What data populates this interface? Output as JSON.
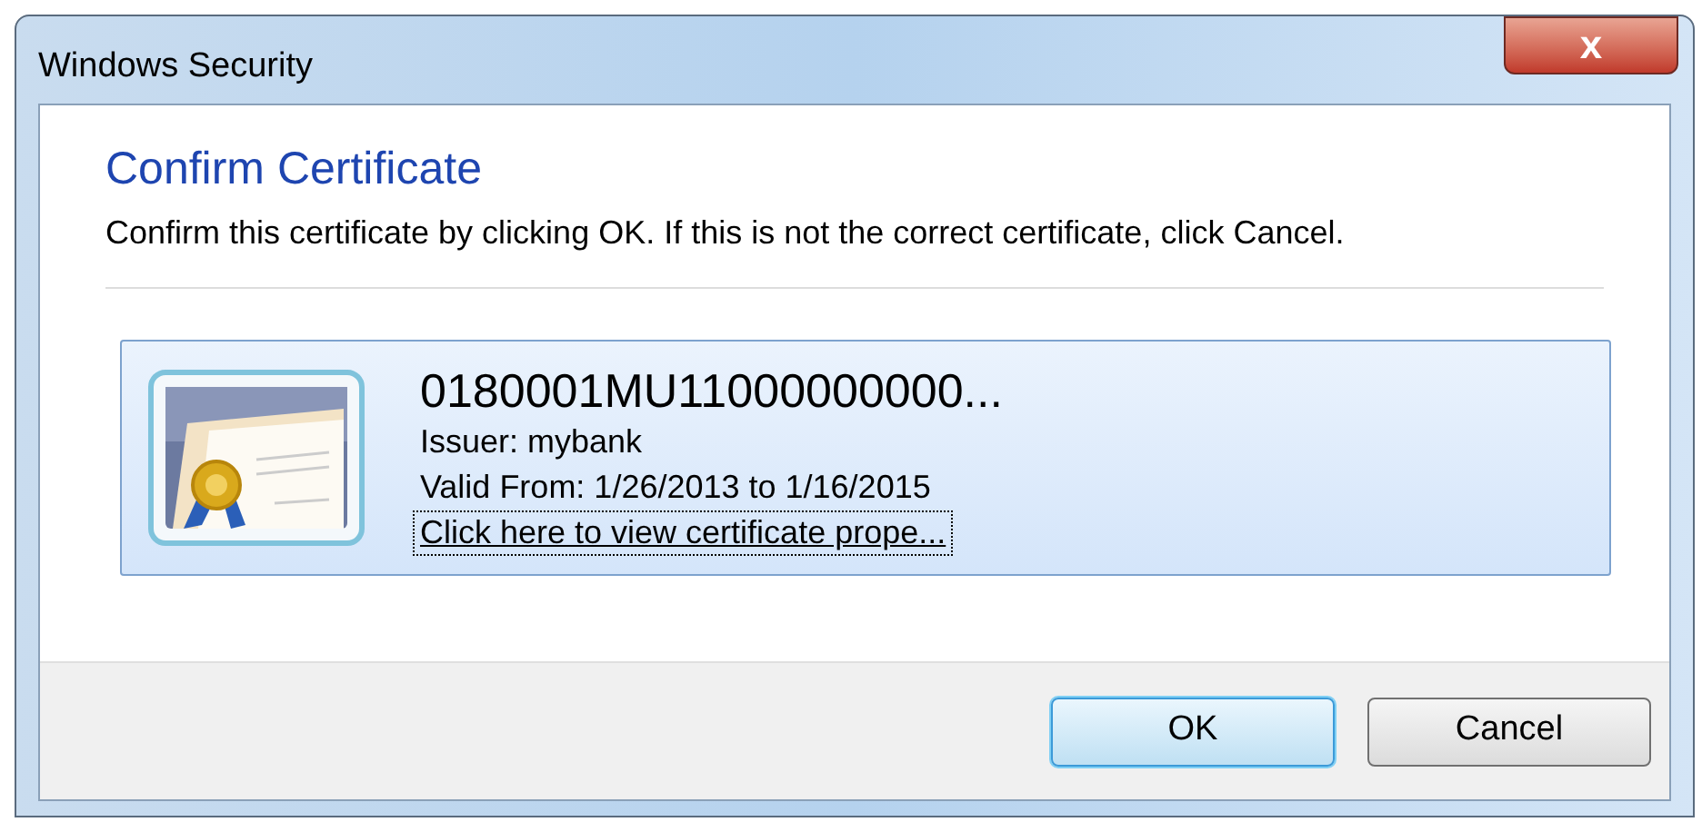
{
  "window": {
    "title": "Windows Security",
    "close": "x"
  },
  "heading": "Confirm Certificate",
  "message": "Confirm this certificate by clicking OK. If this is not the correct certificate, click Cancel.",
  "certificate": {
    "name": "0180001MU11000000000...",
    "issuer": "Issuer: mybank",
    "validity": "Valid From: 1/26/2013 to 1/16/2015",
    "link": "Click here to view certificate prope...",
    "selected": true
  },
  "buttons": [
    {
      "label": "OK",
      "default": true
    },
    {
      "label": "Cancel",
      "default": false
    }
  ]
}
